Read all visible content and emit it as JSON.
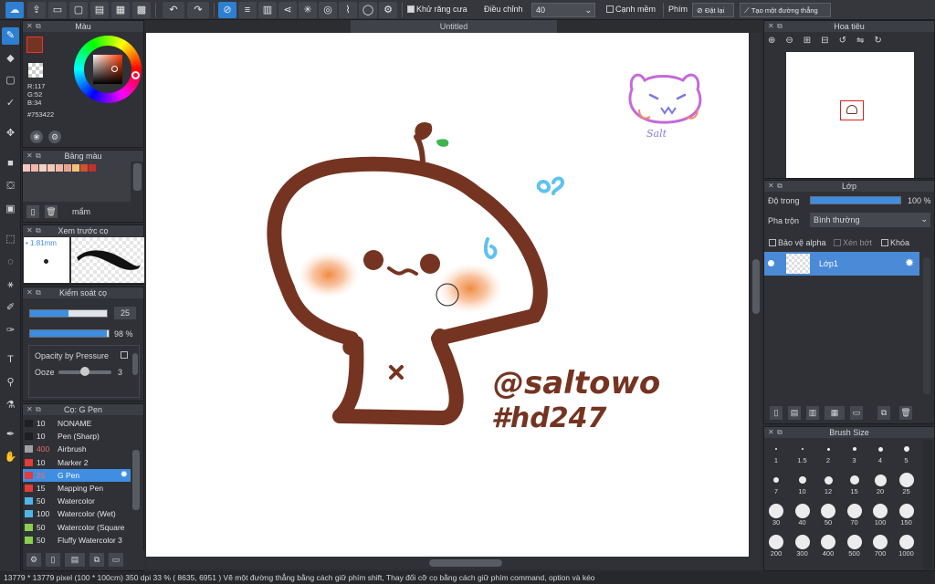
{
  "toolbar": {
    "antialias_label": "Khử răng cưa",
    "adjust_label": "Điều chỉnh",
    "adjust_value": "40",
    "edge_label": "Cạnh mềm",
    "shortcut_label": "Phím",
    "reset_label": "Đặt lại",
    "straight_line_label": "Tạo một đường thẳng"
  },
  "document": {
    "tab_title": "Untitled"
  },
  "color_panel": {
    "title": "Màu",
    "r": "R:117",
    "g": "G:52",
    "b": "B:34",
    "hex": "#753422",
    "fg_color": "#753422",
    "bg_color": "#ffffff"
  },
  "palette_panel": {
    "title": "Bảng màu",
    "name": "mẩm",
    "swatches": [
      "#f4c7c3",
      "#f3b7ae",
      "#f2d2c4",
      "#f6c8b8",
      "#f0b8a6",
      "#e6a48e",
      "#f2c27b",
      "#d0522f",
      "#c4302b"
    ]
  },
  "preview_panel": {
    "title": "Xem trước cọ",
    "size": "1.81mm"
  },
  "brush_control": {
    "title": "Kiểm soát cọ",
    "size_value": "25",
    "size_fraction": 0.5,
    "opacity_value": "98 %",
    "opacity_fraction": 0.98,
    "pressure_label": "Opacity by Pressure",
    "ooze_label": "Ooze",
    "ooze_value": "3"
  },
  "brush_list": {
    "title": "Cọ: G Pen",
    "items": [
      {
        "size": "10",
        "name": "NONAME",
        "color": "#1d1f22",
        "selected": false
      },
      {
        "size": "10",
        "name": "Pen (Sharp)",
        "color": "#1d1f22",
        "selected": false
      },
      {
        "size": "400",
        "name": "Airbrush",
        "color": "#9ea0a4",
        "selected": false
      },
      {
        "size": "10",
        "name": "Marker 2",
        "color": "#e23c3c",
        "selected": false
      },
      {
        "size": "25",
        "name": "G Pen",
        "color": "#e23c3c",
        "selected": true
      },
      {
        "size": "15",
        "name": "Mapping Pen",
        "color": "#e23c3c",
        "selected": false
      },
      {
        "size": "50",
        "name": "Watercolor",
        "color": "#4fb6ea",
        "selected": false
      },
      {
        "size": "100",
        "name": "Watercolor (Wet)",
        "color": "#4fb6ea",
        "selected": false
      },
      {
        "size": "50",
        "name": "Watercolor (Square",
        "color": "#8ccf4f",
        "selected": false
      },
      {
        "size": "50",
        "name": "Fluffy Watercolor 3",
        "color": "#8ccf4f",
        "selected": false
      }
    ]
  },
  "navigator": {
    "title": "Hoa tiêu"
  },
  "layer_panel": {
    "title": "Lớp",
    "opacity_label": "Độ trong",
    "opacity_value": "100 %",
    "opacity_fraction": 1.0,
    "blend_label": "Pha trộn",
    "blend_value": "Bình thường",
    "protect_alpha": "Bảo vệ alpha",
    "clip": "Xén bớt",
    "lock": "Khóa",
    "layer_name": "Lớp1"
  },
  "brush_size_panel": {
    "title": "Brush Size",
    "sizes": [
      "1",
      "1.5",
      "2",
      "3",
      "4",
      "5",
      "7",
      "10",
      "12",
      "15",
      "20",
      "25",
      "30",
      "40",
      "50",
      "70",
      "100",
      "150",
      "200",
      "300",
      "400",
      "500",
      "700",
      "1000"
    ]
  },
  "artwork": {
    "handle": "@saltowo",
    "tag": "#hd247",
    "sticker_text": "Salt"
  },
  "status": {
    "text": "13779 * 13779 pixel  (100 * 100cm)   350 dpi   33 %   ( 8635, 6951 )   Vẽ một đường thẳng bằng cách giữ phím shift, Thay đổi cỡ cọ bằng cách giữ phím command, option và kéo"
  }
}
